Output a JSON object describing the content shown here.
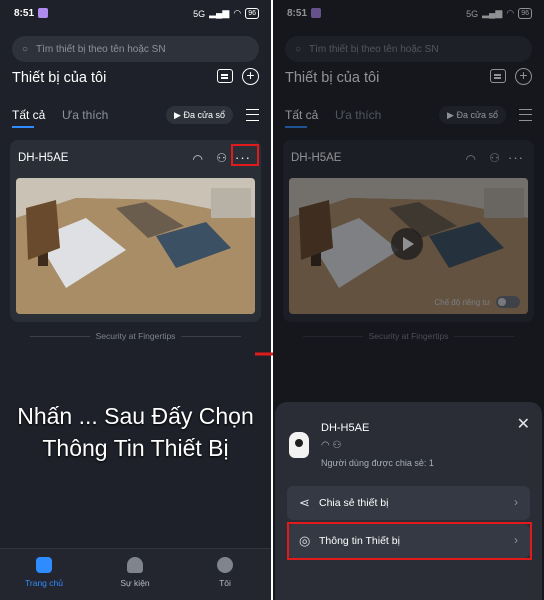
{
  "status_bar": {
    "time": "8:51",
    "signal": "5G",
    "battery": "96"
  },
  "search": {
    "placeholder": "Tìm thiết bị theo tên hoặc SN"
  },
  "header": {
    "title": "Thiết bị của tôi"
  },
  "tabs": {
    "all": "Tất cả",
    "favorites": "Ưa thích",
    "multi_window": "Đa cửa sổ"
  },
  "device": {
    "name": "DH-H5AE"
  },
  "footer_text": "Security at Fingertips",
  "caption": {
    "line1": "Nhấn ... Sau Đấy Chọn",
    "line2": "Thông Tin Thiết Bị"
  },
  "bottom_nav": [
    {
      "label": "Trang chủ"
    },
    {
      "label": "Sự kiện"
    },
    {
      "label": "Tôi"
    }
  ],
  "right_screen": {
    "privacy_mode": "Chế độ riêng tư",
    "sheet": {
      "device_name": "DH-H5AE",
      "shared_users": "Người dùng được chia sẻ: 1",
      "items": [
        {
          "label": "Chia sẻ thiết bị"
        },
        {
          "label": "Thông tin Thiết bị"
        }
      ]
    }
  },
  "colors": {
    "accent": "#2f8cff",
    "highlight": "#e11b1b",
    "background": "#1e2129"
  }
}
